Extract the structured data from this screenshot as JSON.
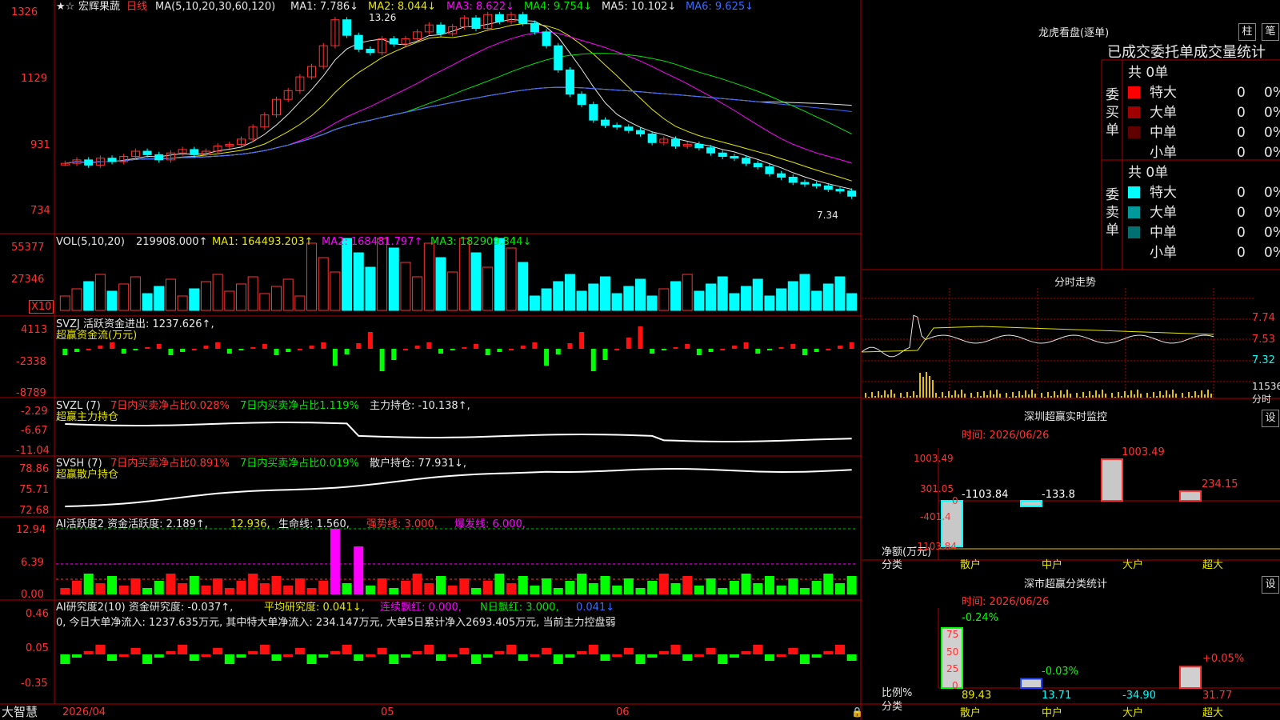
{
  "stock": {
    "name": "宏辉果蔬",
    "period": "日线",
    "ma_label": "MA(5,10,20,30,60,120)",
    "ma1": "MA1: 7.786↓",
    "ma2": "MA2: 8.044↓",
    "ma3": "MA3: 8.622↓",
    "ma4": "MA4: 9.754↓",
    "ma5": "MA5: 10.102↓",
    "ma6": "MA6: 9.625↓",
    "high_label": "13.26",
    "low_label": "7.34",
    "y_ticks": [
      "1326",
      "1129",
      "931",
      "734"
    ]
  },
  "vol": {
    "label": "VOL(5,10,20)",
    "value": "219908.000↑",
    "ma1": "MA1: 164493.203↑",
    "ma2": "MA2: 168481.797↑",
    "ma3": "MA3: 182909.344↓",
    "y_ticks": [
      "55377",
      "27346"
    ],
    "unit": "X10"
  },
  "svzj": {
    "label": "SVZJ  活跃资金进出: 1237.626↑,",
    "name": "超赢资金流(万元)",
    "y_ticks": [
      "4113",
      "-2338",
      "-8789"
    ]
  },
  "svzl": {
    "label": "SVZL (7) ",
    "p1": "7日内买卖净占比0.028%",
    "p2": "7日内买卖净占比1.119%",
    "p3": "主力持仓: -10.138↑,",
    "name": "超赢主力持仓",
    "y_ticks": [
      "-2.29",
      "-6.67",
      "-11.04"
    ]
  },
  "svsh": {
    "label": "SVSH (7) ",
    "p1": "7日内买卖净占比0.891%",
    "p2": "7日内买卖净占比0.019%",
    "p3": "散户持仓: 77.931↓,",
    "name": "超赢散户持仓",
    "y_ticks": [
      "78.86",
      "75.71",
      "72.68"
    ]
  },
  "ai1": {
    "label": "AI活跃度2 资金活跃度: 2.189↑,",
    "v2": "12.936,",
    "v3": "生命线: 1.560,",
    "v4": "强势线: 3.000,",
    "v5": "爆发线: 6.000,",
    "y_ticks": [
      "12.94",
      "6.39",
      "0.00"
    ]
  },
  "ai2": {
    "label": "AI研究度2(10) 资金研究度: -0.037↑,",
    "v2": "平均研究度: 0.041↓,",
    "v3": "连续飘红: 0.000,",
    "v4": "N日飘红: 3.000,",
    "v5": "0.041↓",
    "note": "0, 今日大单净流入: 1237.635万元, 其中特大单净流入: 234.147万元, 大单5日累计净入2693.405万元, 当前主力控盘弱",
    "y_ticks": [
      "0.46",
      "0.05",
      "-0.35"
    ]
  },
  "xaxis": {
    "brand": "大智慧",
    "d1": "2026/04",
    "d2": "05",
    "d3": "06"
  },
  "lhb": {
    "title": "龙虎看盘(逐单)",
    "btn1": "柱",
    "btn2": "笔",
    "subtitle": "已成交委托单成交量统计",
    "buy_label": "委买单",
    "sell_label": "委卖单",
    "buy_total": "共 0单",
    "sell_total": "共 0单",
    "buy_rows": [
      {
        "name": "特大",
        "count": "0",
        "pct": "0%",
        "color": "#ff0000"
      },
      {
        "name": "大单",
        "count": "0",
        "pct": "0%",
        "color": "#a00000"
      },
      {
        "name": "中单",
        "count": "0",
        "pct": "0%",
        "color": "#600000"
      },
      {
        "name": "小单",
        "count": "0",
        "pct": "0%",
        "color": "#000000"
      }
    ],
    "sell_rows": [
      {
        "name": "特大",
        "count": "0",
        "pct": "0%",
        "color": "#00ffff"
      },
      {
        "name": "大单",
        "count": "0",
        "pct": "0%",
        "color": "#009a9a"
      },
      {
        "name": "中单",
        "count": "0",
        "pct": "0%",
        "color": "#007070"
      },
      {
        "name": "小单",
        "count": "0",
        "pct": "0%",
        "color": "#000000"
      }
    ]
  },
  "fenshi": {
    "title": "分时走势",
    "prices": [
      "7.74",
      "7.53",
      "7.32"
    ],
    "vol": "11536",
    "unit": "分时"
  },
  "monitor": {
    "title": "深圳超赢实时监控",
    "btn": "设",
    "date": "时间: 2026/06/26",
    "y_ticks": [
      "1003.49",
      "301.05",
      "0",
      "-401.4",
      "-1103.84"
    ],
    "unit": "净额(万元)",
    "cat": "分类",
    "categories": [
      "散户",
      "中户",
      "大户",
      "超大"
    ],
    "values": [
      -1103.84,
      -133.8,
      1003.49,
      234.15
    ],
    "labels": [
      "-1103.84",
      "-133.8",
      "1003.49",
      "234.15"
    ]
  },
  "stat": {
    "title": "深市超赢分类统计",
    "btn": "设",
    "date": "时间: 2026/06/26",
    "y_ticks": [
      "75",
      "50",
      "25",
      "0"
    ],
    "unit": "比例%",
    "cat": "分类",
    "categories": [
      "散户",
      "中户",
      "大户",
      "超大"
    ],
    "bar_values": [
      89.43,
      13.71,
      0,
      31.77
    ],
    "bottom_labels": [
      "89.43",
      "13.71",
      "-34.90",
      "31.77"
    ],
    "top_labels": [
      "-0.24%",
      "-0.03%",
      "",
      "+0.05%"
    ]
  }
}
